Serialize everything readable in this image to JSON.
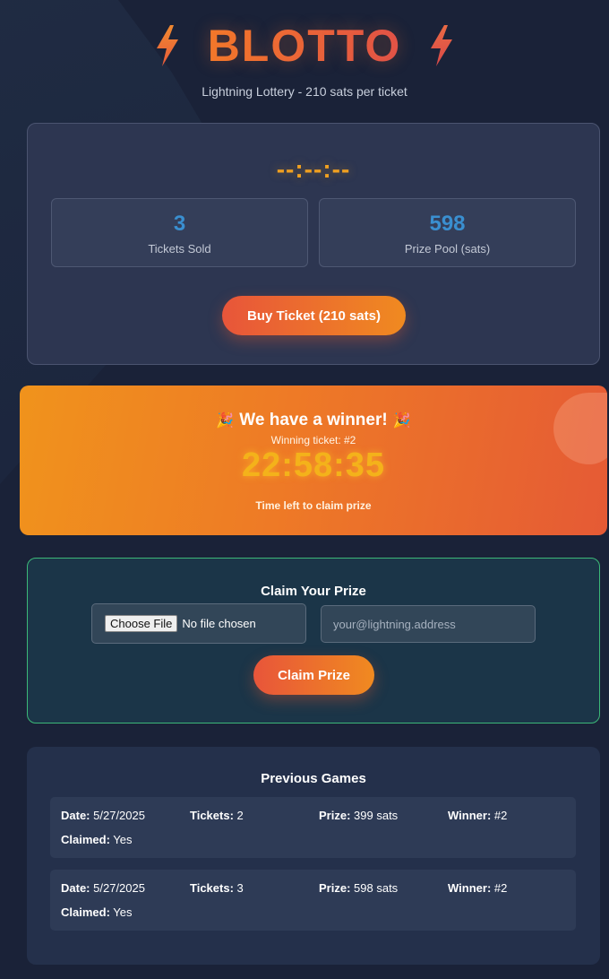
{
  "header": {
    "title": "BLOTTO",
    "subtitle": "Lightning Lottery - 210 sats per ticket"
  },
  "current_game": {
    "countdown": "--:--:--",
    "tickets_sold": "3",
    "tickets_sold_label": "Tickets Sold",
    "prize_pool": "598",
    "prize_pool_label": "Prize Pool (sats)",
    "buy_button": "Buy Ticket (210 sats)"
  },
  "winner": {
    "heading": "We have a winner!",
    "ticket": "Winning ticket: #2",
    "timer": "22:58:35",
    "caption": "Time left to claim prize"
  },
  "claim": {
    "title": "Claim Your Prize",
    "file_button": "Choose File",
    "file_status": "No file chosen",
    "address_placeholder": "your@lightning.address",
    "claim_button": "Claim Prize"
  },
  "history": {
    "title": "Previous Games",
    "labels": {
      "date": "Date:",
      "tickets": "Tickets:",
      "prize": "Prize:",
      "winner": "Winner:",
      "claimed": "Claimed:"
    },
    "games": [
      {
        "date": "5/27/2025",
        "tickets": "2",
        "prize": "399 sats",
        "winner": "#2",
        "claimed": "Yes"
      },
      {
        "date": "5/27/2025",
        "tickets": "3",
        "prize": "598 sats",
        "winner": "#2",
        "claimed": "Yes"
      }
    ]
  },
  "colors": {
    "background": "#1a2238",
    "accent_orange": "#f08a20",
    "accent_red": "#e8553a",
    "stat_blue": "#3a8fd0",
    "claim_border": "#3cb878"
  },
  "icons": {
    "title_left": "lightning-bolt-icon",
    "title_right": "lightning-bolt-icon",
    "winner_left": "party-popper-icon",
    "winner_right": "party-popper-icon"
  }
}
